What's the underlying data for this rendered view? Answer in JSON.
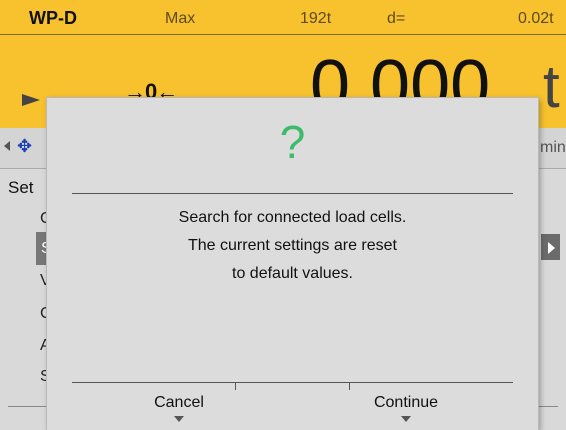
{
  "header": {
    "device": "WP-D",
    "max_label": "Max",
    "max_value": "192t",
    "d_label": "d=",
    "d_value": "0.02t",
    "zero_indicator": "→0←",
    "weight": "0.000",
    "unit": "t"
  },
  "statusbar": {
    "right_text": "min"
  },
  "background_menu": {
    "title": "Set",
    "items": [
      "C",
      "S",
      "V",
      "C",
      "A",
      "S"
    ]
  },
  "dialog": {
    "icon": "question-mark-icon",
    "message_lines": [
      "Search for connected load cells.",
      "The current settings are reset",
      "to default values."
    ],
    "cancel_label": "Cancel",
    "continue_label": "Continue"
  },
  "colors": {
    "header_bg": "#f7c22e",
    "question_mark": "#3dbb6b",
    "usb_icon": "#1a3fb8"
  }
}
